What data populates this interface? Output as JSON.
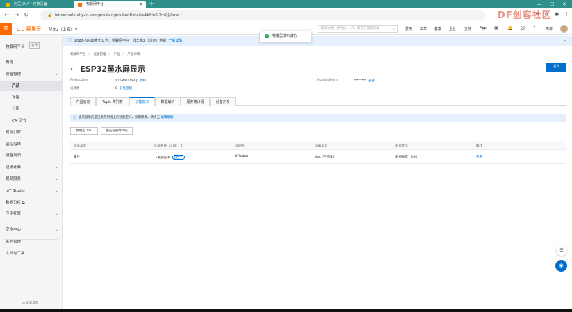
{
  "browser": {
    "tabs": [
      {
        "title": "阿里云IoT - 在稿页面",
        "active": false,
        "favicon_color": "#f0b400"
      },
      {
        "title": "物联网平台",
        "active": true,
        "favicon_color": "#ff6a00"
      }
    ],
    "new_tab": "+",
    "url": "iot.console.aliyun.com/product/productDetail/a1bMrrO7mQJ/func",
    "watermark": "DF创客社区"
  },
  "console": {
    "menu_icon": "≡",
    "logo": "阿里云",
    "region": "华东2（上海）",
    "search_placeholder": "搜索文档、控制台、API、解决方案和资源",
    "links": [
      "费用",
      "工单",
      "备案",
      "企业",
      "支持",
      "App"
    ],
    "user": "简体"
  },
  "sidebar": {
    "title": "物联网平台",
    "badge": "公共",
    "items": [
      {
        "label": "概览",
        "chevron": false,
        "sub": false
      },
      {
        "label": "设备管理",
        "chevron": true,
        "sub": false
      },
      {
        "label": "产品",
        "chevron": false,
        "sub": true,
        "active": true
      },
      {
        "label": "设备",
        "chevron": false,
        "sub": true
      },
      {
        "label": "分组",
        "chevron": false,
        "sub": true
      },
      {
        "label": "CA 证书",
        "chevron": false,
        "sub": true
      },
      {
        "label": "规则引擎",
        "chevron": true,
        "sub": false
      },
      {
        "label": "监控运维",
        "chevron": true,
        "sub": false
      },
      {
        "label": "设备划归",
        "chevron": true,
        "sub": false
      },
      {
        "label": "边缘计算",
        "chevron": true,
        "sub": false
      },
      {
        "label": "视频服务",
        "chevron": true,
        "sub": false
      },
      {
        "label": "IoT Studio",
        "chevron": true,
        "sub": false
      },
      {
        "label": "数据分析 ⧉",
        "chevron": false,
        "sub": false
      },
      {
        "label": "应用托管",
        "chevron": true,
        "sub": false
      },
      {
        "label": "安全中心",
        "chevron": true,
        "sub": false
      },
      {
        "label": "实例管理",
        "chevron": false,
        "sub": false
      },
      {
        "label": "文档与工具",
        "chevron": false,
        "sub": false
      }
    ],
    "footer": "新版反馈"
  },
  "announcement": {
    "text": "2020-08-28发布公告：物联网平台上线华东2（北京）地域",
    "link": "了解详情"
  },
  "toast": "物模型发布成功",
  "breadcrumbs": [
    "物联网平台",
    "设备管理",
    "产品",
    "产品详情"
  ],
  "page": {
    "title": "ESP32墨水屏显示",
    "publish_button": "发布",
    "product_key_label": "ProductKey",
    "product_key_value": "a1bMrrO7mQJ",
    "copy_link": "复制",
    "device_count_label": "设备数",
    "device_count_value": "0",
    "manage_link": "前往管理",
    "product_secret_label": "ProductSecret",
    "product_secret_value": "********",
    "view_link": "查看"
  },
  "tabs": [
    "产品信息",
    "Topic 类列表",
    "功能定义",
    "数据解析",
    "服务端订阅",
    "设备开发"
  ],
  "notice": {
    "text": "当前展示的是已发布到线上的功能定义，如需修改，请点击",
    "link": "编辑草稿"
  },
  "buttons": {
    "tsl": "物模型 TSL",
    "gen_code": "生成设备端代码"
  },
  "table": {
    "headers": [
      "功能类型",
      "功能名称（全部）",
      "标识符",
      "数据类型",
      "数据定义",
      "操作"
    ],
    "rows": [
      {
        "type": "属性",
        "name": "下发字符串",
        "tag": "自定义",
        "identifier": "DFRobot",
        "data_type": "text (字符串)",
        "definition": "数据长度：100",
        "action": "查看"
      }
    ]
  },
  "colors": {
    "browser_bar": "#2f8f8b",
    "brand_orange": "#ff6a00",
    "primary_blue": "#0070cc",
    "success_green": "#1aa34a"
  }
}
